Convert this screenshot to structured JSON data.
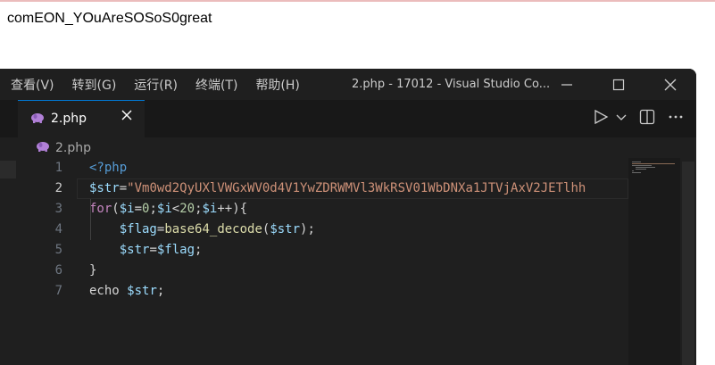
{
  "output_text": "comEON_YOuAreSOSoS0great",
  "window": {
    "menu": [
      "查看(V)",
      "转到(G)",
      "运行(R)",
      "终端(T)",
      "帮助(H)"
    ],
    "title": "2.php - 17012 - Visual Studio Co..."
  },
  "tab": {
    "label": "2.php"
  },
  "breadcrumb": {
    "label": "2.php"
  },
  "code": {
    "line_numbers": [
      "1",
      "2",
      "3",
      "4",
      "5",
      "6",
      "7"
    ],
    "line1": {
      "tag": "<?php"
    },
    "line2": {
      "var": "$str",
      "eq": "=",
      "string": "\"Vm0wd2QyUXlVWGxWV0d4V1YwZDRWMVl3WkRSV01WbDNXa1JTVjAxV2JETlhh"
    },
    "line3": {
      "kw": "for",
      "p1": "(",
      "v1": "$i",
      "eq1": "=",
      "n1": "0",
      "semi1": ";",
      "v2": "$i",
      "lt": "<",
      "n2": "20",
      "semi2": ";",
      "v3": "$i",
      "inc": "++",
      "p2": "){"
    },
    "line4": {
      "v1": "$flag",
      "eq": "=",
      "fn": "base64_decode",
      "p1": "(",
      "v2": "$str",
      "p2": ");"
    },
    "line5": {
      "v1": "$str",
      "eq": "=",
      "v2": "$flag",
      "semi": ";"
    },
    "line6": {
      "brace": "}"
    },
    "line7": {
      "kw": "echo",
      "v": "$str",
      "semi": ";"
    }
  },
  "icons": {
    "php_file": "elephant-icon",
    "close": "close-icon",
    "run": "run-icon",
    "dropdown": "chevron-down-icon",
    "split": "split-editor-icon",
    "more": "more-actions-icon",
    "minimize": "minimize-icon",
    "maximize": "maximize-icon",
    "close_window": "close-window-icon"
  },
  "colors": {
    "editor_bg": "#1f1f1f",
    "tab_accent": "#0078d4",
    "keyword": "#569cd6",
    "variable": "#9cdcfe",
    "string": "#ce9178",
    "function": "#dcdcaa",
    "number": "#b5cea8",
    "php_icon": "#b180d7"
  }
}
